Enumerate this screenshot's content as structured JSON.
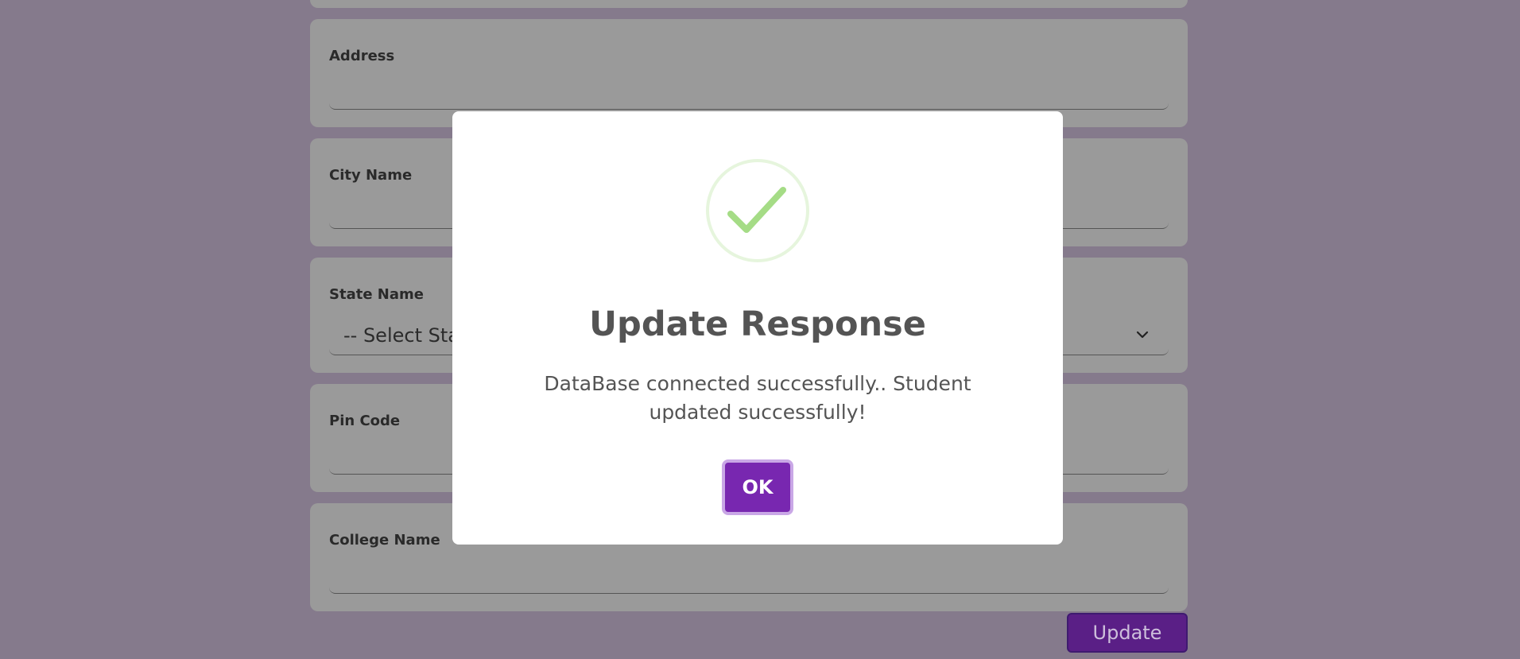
{
  "form": {
    "fields": [
      {
        "label": "Address"
      },
      {
        "label": "City Name"
      },
      {
        "label": "State Name",
        "selected": "-- Select State --"
      },
      {
        "label": "Pin Code"
      },
      {
        "label": "College Name"
      }
    ],
    "update_label": "Update"
  },
  "modal": {
    "icon": "success-checkmark-icon",
    "title": "Update Response",
    "message": "DataBase connected successfully.. Student updated successfully!",
    "ok_label": "OK"
  },
  "colors": {
    "overlay": "#857a8c",
    "card": "#9a9a9a",
    "accent": "#7827b0",
    "success": "#a5dc86"
  }
}
